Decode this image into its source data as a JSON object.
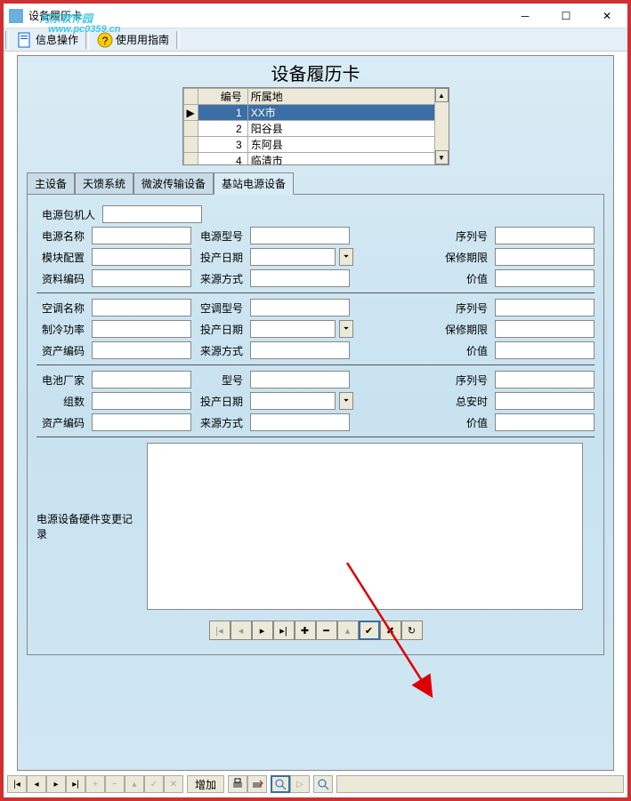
{
  "window": {
    "title": "设备履历卡"
  },
  "menu": {
    "info_ops": "信息操作",
    "help_guide": "使用用指南"
  },
  "watermark": {
    "text": "河东软件园",
    "url": "www.pc0359.cn"
  },
  "card": {
    "title": "设备履历卡"
  },
  "grid": {
    "headers": {
      "id": "编号",
      "loc": "所属地"
    },
    "rows": [
      {
        "id": "1",
        "loc": "XX市",
        "selected": true
      },
      {
        "id": "2",
        "loc": "阳谷县",
        "selected": false
      },
      {
        "id": "3",
        "loc": "东阿县",
        "selected": false
      },
      {
        "id": "4",
        "loc": "临清市",
        "selected": false
      }
    ]
  },
  "tabs": [
    {
      "label": "主设备",
      "active": false
    },
    {
      "label": "天馈系统",
      "active": false
    },
    {
      "label": "微波传输设备",
      "active": false
    },
    {
      "label": "基站电源设备",
      "active": true
    }
  ],
  "form": {
    "power_owner": "电源包机人",
    "sec1": {
      "name": "电源名称",
      "model": "电源型号",
      "serial": "序列号",
      "module": "模块配置",
      "date": "投产日期",
      "warranty": "保修期限",
      "asset": "资料编码",
      "source": "来源方式",
      "value": "价值"
    },
    "sec2": {
      "name": "空调名称",
      "model": "空调型号",
      "serial": "序列号",
      "power": "制冷功率",
      "date": "投产日期",
      "warranty": "保修期限",
      "asset": "资产编码",
      "source": "来源方式",
      "value": "价值"
    },
    "sec3": {
      "vendor": "电池厂家",
      "model": "型号",
      "serial": "序列号",
      "groups": "组数",
      "date": "投产日期",
      "ah": "总安时",
      "asset": "资产编码",
      "source": "来源方式",
      "value": "价值"
    },
    "changelog": "电源设备硬件变更记录"
  },
  "nav_inner": {
    "first": "⏮",
    "prev": "◀",
    "next": "▶",
    "last": "⏭",
    "add": "✚",
    "del": "━",
    "edit": "▲",
    "post": "✔",
    "cancel": "✖",
    "refresh": "↻"
  },
  "bottom": {
    "add_label": "增加"
  }
}
